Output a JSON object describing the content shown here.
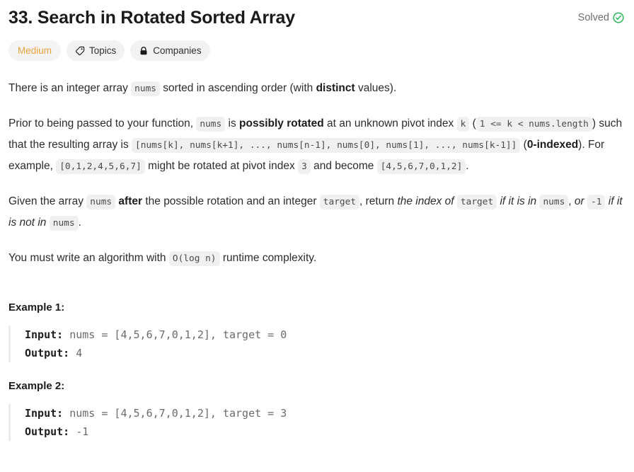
{
  "header": {
    "title": "33. Search in Rotated Sorted Array",
    "status_label": "Solved",
    "status_icon": "check-circle-icon",
    "status_color": "#2db55d",
    "status_text_color": "#6f6f6f"
  },
  "badges": {
    "difficulty": {
      "label": "Medium",
      "color": "#e8a33d",
      "background": "#f4f4f4"
    },
    "topics": {
      "label": "Topics",
      "icon": "tag-icon"
    },
    "companies": {
      "label": "Companies",
      "icon": "lock-icon"
    }
  },
  "description": {
    "p1": {
      "t1": "There is an integer array ",
      "c1": "nums",
      "t2": " sorted in ascending order (with ",
      "b1": "distinct",
      "t3": " values)."
    },
    "p2": {
      "t1": "Prior to being passed to your function, ",
      "c1": "nums",
      "t2": " is ",
      "b1": "possibly rotated",
      "t3": " at an unknown pivot index ",
      "c2": "k",
      "t4": " (",
      "c3": "1 <= k < nums.length",
      "t5": ") such that the resulting array is ",
      "c4": "[nums[k], nums[k+1], ..., nums[n-1], nums[0], nums[1], ..., nums[k-1]]",
      "t6": " (",
      "b2": "0-indexed",
      "t7": "). For example, ",
      "c5": "[0,1,2,4,5,6,7]",
      "t8": " might be rotated at pivot index ",
      "c6": "3",
      "t9": " and become ",
      "c7": "[4,5,6,7,0,1,2]",
      "t10": "."
    },
    "p3": {
      "t1": "Given the array ",
      "c1": "nums",
      "t2": " ",
      "b1": "after",
      "t3": " the possible rotation and an integer ",
      "c2": "target",
      "t4": ", return ",
      "i1": "the index of",
      "t5": " ",
      "c3": "target",
      "t6": " ",
      "i2": "if it is in",
      "t7": " ",
      "c4": "nums",
      "t8": ", ",
      "i3": "or",
      "t9": " ",
      "c5": "-1",
      "t10": " ",
      "i4": "if it is not in",
      "t11": " ",
      "c6": "nums",
      "t12": "."
    },
    "p4": {
      "t1": "You must write an algorithm with ",
      "c1": "O(log n)",
      "t2": " runtime complexity."
    }
  },
  "examples": [
    {
      "heading": "Example 1:",
      "input_label": "Input:",
      "input_value": " nums = [4,5,6,7,0,1,2], target = 0",
      "output_label": "Output:",
      "output_value": " 4"
    },
    {
      "heading": "Example 2:",
      "input_label": "Input:",
      "input_value": " nums = [4,5,6,7,0,1,2], target = 3",
      "output_label": "Output:",
      "output_value": " -1"
    }
  ]
}
